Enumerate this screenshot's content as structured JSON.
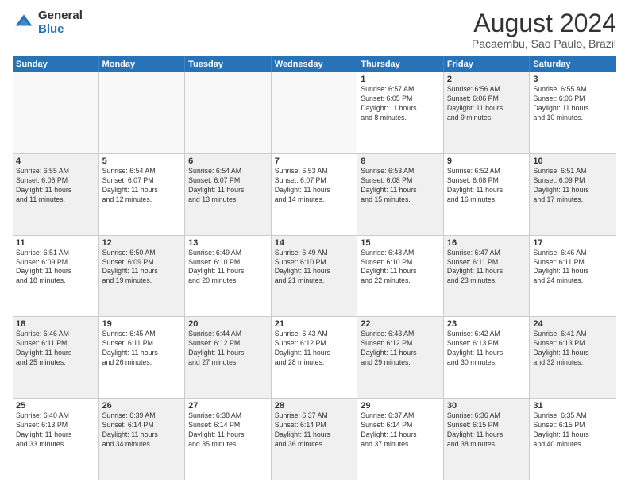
{
  "logo": {
    "line1": "General",
    "line2": "Blue"
  },
  "title": "August 2024",
  "location": "Pacaembu, Sao Paulo, Brazil",
  "days_of_week": [
    "Sunday",
    "Monday",
    "Tuesday",
    "Wednesday",
    "Thursday",
    "Friday",
    "Saturday"
  ],
  "weeks": [
    [
      {
        "day": "",
        "info": "",
        "shaded": false,
        "empty": true
      },
      {
        "day": "",
        "info": "",
        "shaded": false,
        "empty": true
      },
      {
        "day": "",
        "info": "",
        "shaded": false,
        "empty": true
      },
      {
        "day": "",
        "info": "",
        "shaded": false,
        "empty": true
      },
      {
        "day": "1",
        "info": "Sunrise: 6:57 AM\nSunset: 6:05 PM\nDaylight: 11 hours\nand 8 minutes.",
        "shaded": false,
        "empty": false
      },
      {
        "day": "2",
        "info": "Sunrise: 6:56 AM\nSunset: 6:06 PM\nDaylight: 11 hours\nand 9 minutes.",
        "shaded": true,
        "empty": false
      },
      {
        "day": "3",
        "info": "Sunrise: 6:55 AM\nSunset: 6:06 PM\nDaylight: 11 hours\nand 10 minutes.",
        "shaded": false,
        "empty": false
      }
    ],
    [
      {
        "day": "4",
        "info": "Sunrise: 6:55 AM\nSunset: 6:06 PM\nDaylight: 11 hours\nand 11 minutes.",
        "shaded": true,
        "empty": false
      },
      {
        "day": "5",
        "info": "Sunrise: 6:54 AM\nSunset: 6:07 PM\nDaylight: 11 hours\nand 12 minutes.",
        "shaded": false,
        "empty": false
      },
      {
        "day": "6",
        "info": "Sunrise: 6:54 AM\nSunset: 6:07 PM\nDaylight: 11 hours\nand 13 minutes.",
        "shaded": true,
        "empty": false
      },
      {
        "day": "7",
        "info": "Sunrise: 6:53 AM\nSunset: 6:07 PM\nDaylight: 11 hours\nand 14 minutes.",
        "shaded": false,
        "empty": false
      },
      {
        "day": "8",
        "info": "Sunrise: 6:53 AM\nSunset: 6:08 PM\nDaylight: 11 hours\nand 15 minutes.",
        "shaded": true,
        "empty": false
      },
      {
        "day": "9",
        "info": "Sunrise: 6:52 AM\nSunset: 6:08 PM\nDaylight: 11 hours\nand 16 minutes.",
        "shaded": false,
        "empty": false
      },
      {
        "day": "10",
        "info": "Sunrise: 6:51 AM\nSunset: 6:09 PM\nDaylight: 11 hours\nand 17 minutes.",
        "shaded": true,
        "empty": false
      }
    ],
    [
      {
        "day": "11",
        "info": "Sunrise: 6:51 AM\nSunset: 6:09 PM\nDaylight: 11 hours\nand 18 minutes.",
        "shaded": false,
        "empty": false
      },
      {
        "day": "12",
        "info": "Sunrise: 6:50 AM\nSunset: 6:09 PM\nDaylight: 11 hours\nand 19 minutes.",
        "shaded": true,
        "empty": false
      },
      {
        "day": "13",
        "info": "Sunrise: 6:49 AM\nSunset: 6:10 PM\nDaylight: 11 hours\nand 20 minutes.",
        "shaded": false,
        "empty": false
      },
      {
        "day": "14",
        "info": "Sunrise: 6:49 AM\nSunset: 6:10 PM\nDaylight: 11 hours\nand 21 minutes.",
        "shaded": true,
        "empty": false
      },
      {
        "day": "15",
        "info": "Sunrise: 6:48 AM\nSunset: 6:10 PM\nDaylight: 11 hours\nand 22 minutes.",
        "shaded": false,
        "empty": false
      },
      {
        "day": "16",
        "info": "Sunrise: 6:47 AM\nSunset: 6:11 PM\nDaylight: 11 hours\nand 23 minutes.",
        "shaded": true,
        "empty": false
      },
      {
        "day": "17",
        "info": "Sunrise: 6:46 AM\nSunset: 6:11 PM\nDaylight: 11 hours\nand 24 minutes.",
        "shaded": false,
        "empty": false
      }
    ],
    [
      {
        "day": "18",
        "info": "Sunrise: 6:46 AM\nSunset: 6:11 PM\nDaylight: 11 hours\nand 25 minutes.",
        "shaded": true,
        "empty": false
      },
      {
        "day": "19",
        "info": "Sunrise: 6:45 AM\nSunset: 6:11 PM\nDaylight: 11 hours\nand 26 minutes.",
        "shaded": false,
        "empty": false
      },
      {
        "day": "20",
        "info": "Sunrise: 6:44 AM\nSunset: 6:12 PM\nDaylight: 11 hours\nand 27 minutes.",
        "shaded": true,
        "empty": false
      },
      {
        "day": "21",
        "info": "Sunrise: 6:43 AM\nSunset: 6:12 PM\nDaylight: 11 hours\nand 28 minutes.",
        "shaded": false,
        "empty": false
      },
      {
        "day": "22",
        "info": "Sunrise: 6:43 AM\nSunset: 6:12 PM\nDaylight: 11 hours\nand 29 minutes.",
        "shaded": true,
        "empty": false
      },
      {
        "day": "23",
        "info": "Sunrise: 6:42 AM\nSunset: 6:13 PM\nDaylight: 11 hours\nand 30 minutes.",
        "shaded": false,
        "empty": false
      },
      {
        "day": "24",
        "info": "Sunrise: 6:41 AM\nSunset: 6:13 PM\nDaylight: 11 hours\nand 32 minutes.",
        "shaded": true,
        "empty": false
      }
    ],
    [
      {
        "day": "25",
        "info": "Sunrise: 6:40 AM\nSunset: 6:13 PM\nDaylight: 11 hours\nand 33 minutes.",
        "shaded": false,
        "empty": false
      },
      {
        "day": "26",
        "info": "Sunrise: 6:39 AM\nSunset: 6:14 PM\nDaylight: 11 hours\nand 34 minutes.",
        "shaded": true,
        "empty": false
      },
      {
        "day": "27",
        "info": "Sunrise: 6:38 AM\nSunset: 6:14 PM\nDaylight: 11 hours\nand 35 minutes.",
        "shaded": false,
        "empty": false
      },
      {
        "day": "28",
        "info": "Sunrise: 6:37 AM\nSunset: 6:14 PM\nDaylight: 11 hours\nand 36 minutes.",
        "shaded": true,
        "empty": false
      },
      {
        "day": "29",
        "info": "Sunrise: 6:37 AM\nSunset: 6:14 PM\nDaylight: 11 hours\nand 37 minutes.",
        "shaded": false,
        "empty": false
      },
      {
        "day": "30",
        "info": "Sunrise: 6:36 AM\nSunset: 6:15 PM\nDaylight: 11 hours\nand 38 minutes.",
        "shaded": true,
        "empty": false
      },
      {
        "day": "31",
        "info": "Sunrise: 6:35 AM\nSunset: 6:15 PM\nDaylight: 11 hours\nand 40 minutes.",
        "shaded": false,
        "empty": false
      }
    ]
  ]
}
